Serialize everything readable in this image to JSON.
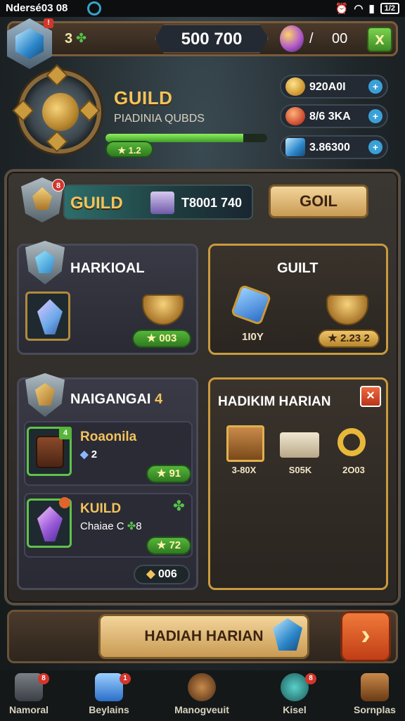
{
  "status_bar": {
    "time": "Ndersé03 08",
    "battery": "1/2"
  },
  "top_bar": {
    "small_value": "3",
    "coins": "500 700",
    "slash": "/",
    "right_value": "00",
    "badge": "x"
  },
  "guild_header": {
    "title": "GUILD",
    "subtitle": "PIADINIA QUBDS",
    "level_pill": "1.2",
    "resources": [
      {
        "value": "920A0I",
        "icon": "gold-coin-icon",
        "color": "#e2b33c"
      },
      {
        "value": "8/6 3KA",
        "icon": "flame-orb-icon",
        "color": "#d6542a"
      },
      {
        "value": "3.86300",
        "icon": "blue-gem-icon",
        "color": "#3a8fd6"
      }
    ],
    "xp_fraction": 0.85
  },
  "guild_bar": {
    "label": "GUILD",
    "badge": "8",
    "value": "T8001 740",
    "button": "GOIL"
  },
  "card_harkioal": {
    "title": "HARKIOAL",
    "pill": "003"
  },
  "card_guilt": {
    "title": "GUILT",
    "item_label": "1I0Y",
    "pill": "2.23 2"
  },
  "card_naigangai": {
    "title": "NAIGANGAI",
    "title_suffix": "4",
    "row1": {
      "name": "Roaonila",
      "sub": "2",
      "pill": "91",
      "badge": "4"
    },
    "row2": {
      "name": "KUILD",
      "sub": "Chaiae C",
      "sub_value": "8",
      "pill": "72"
    },
    "footer_pill": "006"
  },
  "card_hadikim": {
    "title": "HADIKIM HARIAN",
    "items": [
      {
        "label": "3-80X",
        "icon": "gift-box-icon"
      },
      {
        "label": "S05K",
        "icon": "parcel-icon"
      },
      {
        "label": "2O03",
        "icon": "gold-ring-icon"
      }
    ]
  },
  "action_bar": {
    "button": "HADIAH HARIAN",
    "next": "›"
  },
  "bottom_nav": [
    {
      "label": "Namoral",
      "badge": "8",
      "icon": "chest-icon"
    },
    {
      "label": "Beylains",
      "badge": "1",
      "icon": "crystal-icon"
    },
    {
      "label": "Manogveuit",
      "badge": "",
      "icon": "bag-icon"
    },
    {
      "label": "Kisel",
      "badge": "8",
      "icon": "globe-icon"
    },
    {
      "label": "Sornplas",
      "badge": "",
      "icon": "anvil-icon"
    }
  ],
  "colors": {
    "gold": "#f2c35c",
    "green": "#56b53a",
    "panel": "#2a2724"
  }
}
